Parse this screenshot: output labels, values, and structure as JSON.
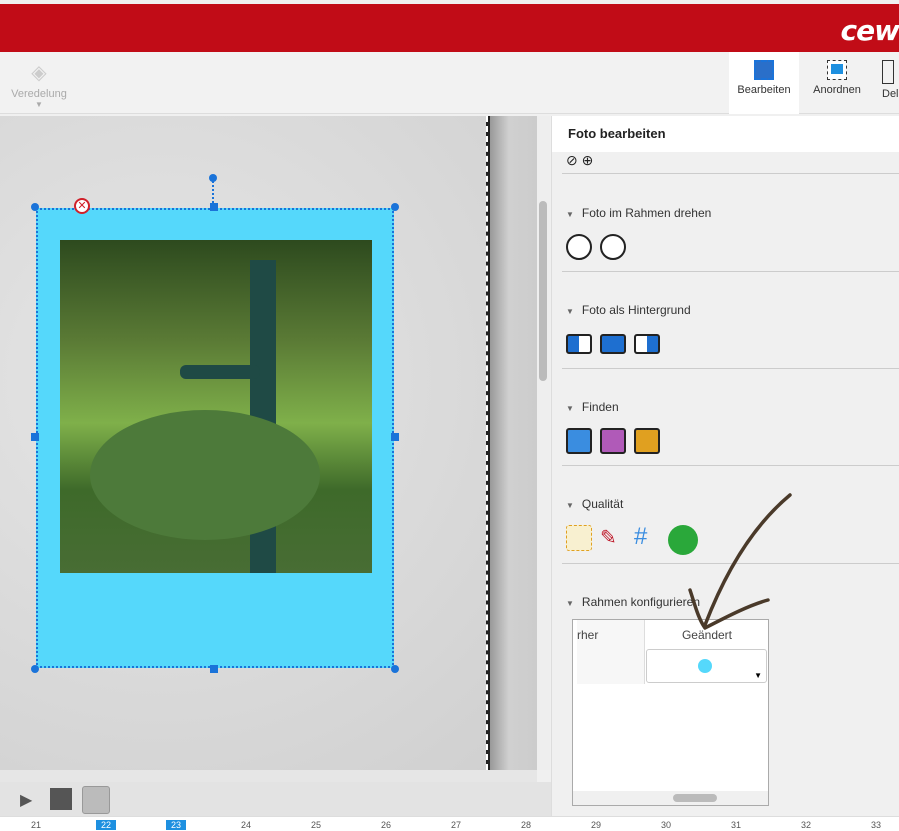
{
  "brand": {
    "logo": "cew",
    "color": "#c10c17"
  },
  "toolbar": {
    "veredelung": "Veredelung",
    "bearbeiten": "Bearbeiten",
    "anordnen": "Anordnen",
    "del": "Del"
  },
  "panel": {
    "title": "Foto bearbeiten",
    "sections": [
      "Foto im Rahmen drehen",
      "Foto als Hintergrund",
      "Finden",
      "Qualität",
      "Rahmen konfigurieren"
    ],
    "table": {
      "col_before": "rher",
      "col_changed": "Geändert",
      "frame_color": "#55d8fb"
    }
  },
  "pages": [
    "21",
    "22",
    "23",
    "24",
    "25",
    "26",
    "27",
    "28",
    "29",
    "30",
    "31",
    "32",
    "33"
  ],
  "selected_pages": [
    "22",
    "23"
  ],
  "frame": {
    "color": "#55d8fb"
  }
}
